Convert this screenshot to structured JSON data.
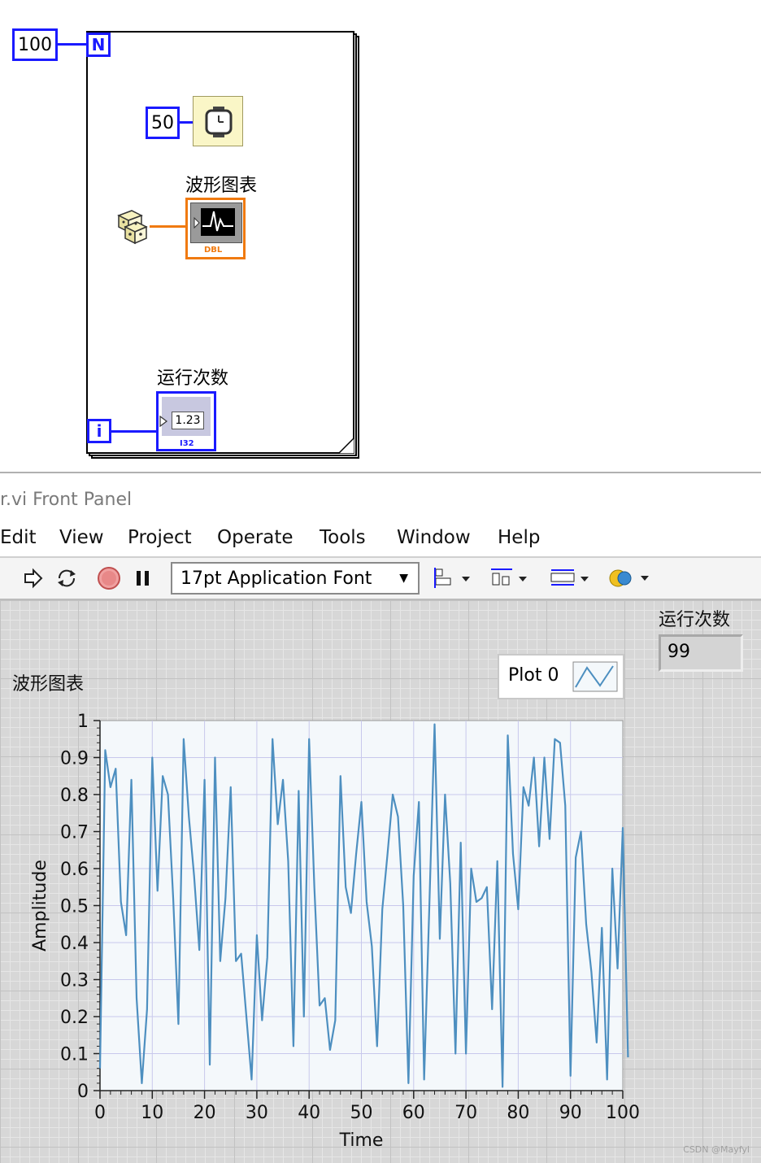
{
  "diagram": {
    "loop_count": "100",
    "loop_terminal": "N",
    "iteration_terminal": "i",
    "wait_ms": "50",
    "chart_label": "波形图表",
    "chart_terminal_type": "DBL",
    "count_label": "运行次数",
    "count_terminal_value": "1.23",
    "count_terminal_type": "I32"
  },
  "window": {
    "title": "r.vi Front Panel"
  },
  "menu": [
    "Edit",
    "View",
    "Project",
    "Operate",
    "Tools",
    "Window",
    "Help"
  ],
  "toolbar": {
    "font": "17pt Application Font"
  },
  "panel": {
    "count_label": "运行次数",
    "count_value": "99",
    "chart_label": "波形图表",
    "legend_plot": "Plot 0"
  },
  "watermark": "CSDN @Mayfyl",
  "chart_data": {
    "type": "line",
    "xlabel": "Time",
    "ylabel": "Amplitude",
    "xlim": [
      0,
      100
    ],
    "ylim": [
      0,
      1
    ],
    "x_ticks": [
      "0",
      "10",
      "20",
      "30",
      "40",
      "50",
      "60",
      "70",
      "80",
      "90",
      "100"
    ],
    "y_ticks": [
      "0",
      "0.1",
      "0.2",
      "0.3",
      "0.4",
      "0.5",
      "0.6",
      "0.7",
      "0.8",
      "0.9",
      "1"
    ],
    "line_color": "#4d8fc0",
    "grid": true,
    "series": [
      {
        "name": "Plot 0",
        "values": [
          0.06,
          0.92,
          0.82,
          0.87,
          0.51,
          0.42,
          0.84,
          0.25,
          0.02,
          0.22,
          0.9,
          0.54,
          0.85,
          0.8,
          0.52,
          0.18,
          0.95,
          0.74,
          0.58,
          0.38,
          0.84,
          0.07,
          0.9,
          0.35,
          0.52,
          0.82,
          0.35,
          0.37,
          0.2,
          0.03,
          0.42,
          0.19,
          0.36,
          0.95,
          0.72,
          0.84,
          0.62,
          0.12,
          0.81,
          0.2,
          0.95,
          0.55,
          0.23,
          0.25,
          0.11,
          0.19,
          0.85,
          0.55,
          0.48,
          0.64,
          0.78,
          0.51,
          0.39,
          0.12,
          0.49,
          0.64,
          0.8,
          0.74,
          0.5,
          0.02,
          0.58,
          0.78,
          0.03,
          0.5,
          0.99,
          0.41,
          0.8,
          0.56,
          0.1,
          0.67,
          0.1,
          0.6,
          0.51,
          0.52,
          0.55,
          0.22,
          0.62,
          0.01,
          0.96,
          0.64,
          0.49,
          0.82,
          0.77,
          0.9,
          0.66,
          0.9,
          0.68,
          0.95,
          0.94,
          0.77,
          0.04,
          0.63,
          0.7,
          0.45,
          0.32,
          0.13,
          0.44,
          0.03,
          0.6,
          0.33,
          0.71,
          0.09
        ]
      }
    ]
  }
}
